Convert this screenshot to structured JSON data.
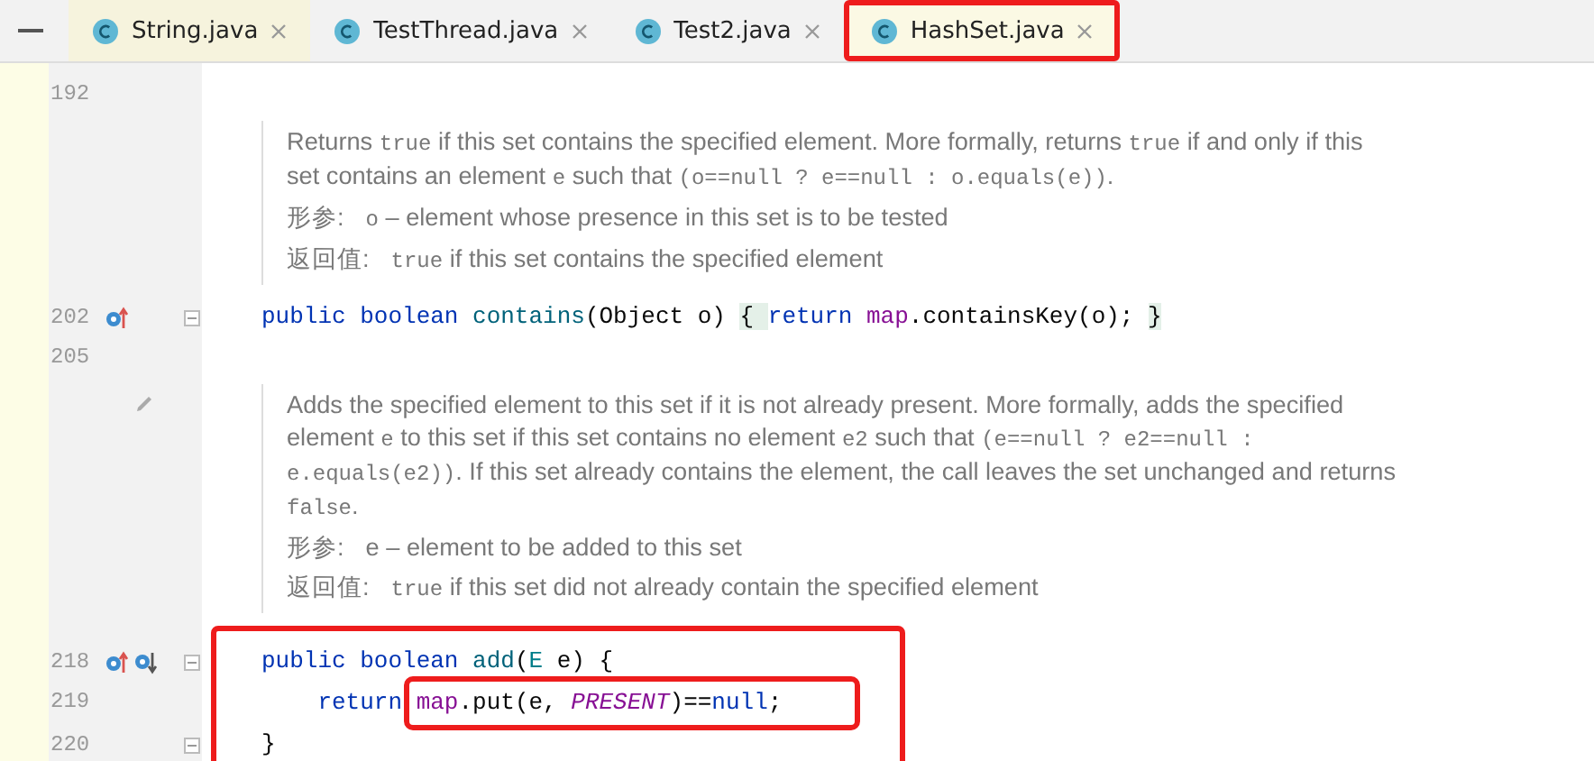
{
  "tabs": [
    {
      "label": "String.java",
      "selected": false,
      "readonly": true,
      "highlighted": false
    },
    {
      "label": "TestThread.java",
      "selected": false,
      "readonly": false,
      "highlighted": false
    },
    {
      "label": "Test2.java",
      "selected": false,
      "readonly": false,
      "highlighted": false
    },
    {
      "label": "HashSet.java",
      "selected": true,
      "readonly": false,
      "highlighted": true
    }
  ],
  "editor": {
    "rows": [
      {
        "kind": "blank",
        "number": "192",
        "overrides": false,
        "overridden": false,
        "fold": false
      },
      {
        "kind": "doc",
        "edit_icon": false,
        "paragraphs": [
          {
            "kind": "text",
            "segments": [
              {
                "kind": "text",
                "text": "Returns "
              },
              {
                "kind": "code",
                "text": "true"
              },
              {
                "kind": "text",
                "text": " if this set contains the specified element. More formally, returns "
              },
              {
                "kind": "code",
                "text": "true"
              },
              {
                "kind": "text",
                "text": " if and only if this set contains an element "
              },
              {
                "kind": "code",
                "text": "e"
              },
              {
                "kind": "text",
                "text": " such that "
              },
              {
                "kind": "code",
                "text": "(o==null ? e==null : o.equals(e))"
              },
              {
                "kind": "text",
                "text": "."
              }
            ]
          },
          {
            "kind": "param",
            "label": "形参:",
            "segments": [
              {
                "kind": "code",
                "text": "o"
              },
              {
                "kind": "text",
                "text": " – element whose presence in this set is to be tested"
              }
            ]
          },
          {
            "kind": "param",
            "label": "返回值:",
            "segments": [
              {
                "kind": "code",
                "text": "true"
              },
              {
                "kind": "text",
                "text": " if this set contains the specified element"
              }
            ]
          }
        ]
      },
      {
        "kind": "code",
        "number": "202",
        "overrides": true,
        "overridden": false,
        "fold": true,
        "parts": [
          {
            "boxed": false,
            "tokens": [
              {
                "kind": "kw",
                "text": "public boolean "
              },
              {
                "kind": "fn",
                "text": "contains"
              },
              {
                "kind": "plain",
                "text": "(Object o) "
              },
              {
                "kind": "fold",
                "text": "{ "
              },
              {
                "kind": "kw",
                "text": "return "
              },
              {
                "kind": "field",
                "text": "map"
              },
              {
                "kind": "plain",
                "text": ".containsKey(o); "
              },
              {
                "kind": "fold",
                "text": "}"
              }
            ]
          }
        ]
      },
      {
        "kind": "blank",
        "number": "205",
        "overrides": false,
        "overridden": false,
        "fold": false
      },
      {
        "kind": "doc",
        "edit_icon": true,
        "paragraphs": [
          {
            "kind": "text",
            "segments": [
              {
                "kind": "text",
                "text": "Adds the specified element to this set if it is not already present. More formally, adds the specified element "
              },
              {
                "kind": "code",
                "text": "e"
              },
              {
                "kind": "text",
                "text": " to this set if this set contains no element "
              },
              {
                "kind": "code",
                "text": "e2"
              },
              {
                "kind": "text",
                "text": " such that "
              },
              {
                "kind": "code",
                "text": "(e==null ? e2==null : e.equals(e2))"
              },
              {
                "kind": "text",
                "text": ". If this set already contains the element, the call leaves the set unchanged and returns "
              },
              {
                "kind": "code",
                "text": "false"
              },
              {
                "kind": "text",
                "text": "."
              }
            ]
          },
          {
            "kind": "param",
            "label": "形参:",
            "segments": [
              {
                "kind": "text",
                "text": "e – element to be added to this set"
              }
            ]
          },
          {
            "kind": "param",
            "label": "返回值:",
            "segments": [
              {
                "kind": "code",
                "text": "true"
              },
              {
                "kind": "text",
                "text": " if this set did not already contain the specified element"
              }
            ]
          }
        ]
      },
      {
        "kind": "group",
        "highlighted": true,
        "rows": [
          {
            "kind": "code",
            "number": "218",
            "overrides": true,
            "overridden": true,
            "fold": true,
            "parts": [
              {
                "boxed": false,
                "tokens": [
                  {
                    "kind": "kw",
                    "text": "public boolean "
                  },
                  {
                    "kind": "fn",
                    "text": "add"
                  },
                  {
                    "kind": "plain",
                    "text": "("
                  },
                  {
                    "kind": "type",
                    "text": "E"
                  },
                  {
                    "kind": "plain",
                    "text": " e) {"
                  }
                ]
              }
            ]
          },
          {
            "kind": "code",
            "number": "219",
            "overrides": false,
            "overridden": false,
            "fold": false,
            "parts": [
              {
                "boxed": false,
                "tokens": [
                  {
                    "kind": "kw",
                    "text": "    return "
                  }
                ]
              },
              {
                "boxed": true,
                "tokens": [
                  {
                    "kind": "field",
                    "text": "map"
                  },
                  {
                    "kind": "plain",
                    "text": ".put(e, "
                  },
                  {
                    "kind": "const",
                    "text": "PRESENT"
                  },
                  {
                    "kind": "plain",
                    "text": ")=="
                  },
                  {
                    "kind": "kw",
                    "text": "null"
                  },
                  {
                    "kind": "plain",
                    "text": ";"
                  }
                ]
              }
            ]
          },
          {
            "kind": "code",
            "number": "220",
            "overrides": false,
            "overridden": false,
            "fold": true,
            "parts": [
              {
                "boxed": false,
                "tokens": [
                  {
                    "kind": "plain",
                    "text": "}"
                  }
                ]
              }
            ]
          }
        ]
      }
    ]
  }
}
